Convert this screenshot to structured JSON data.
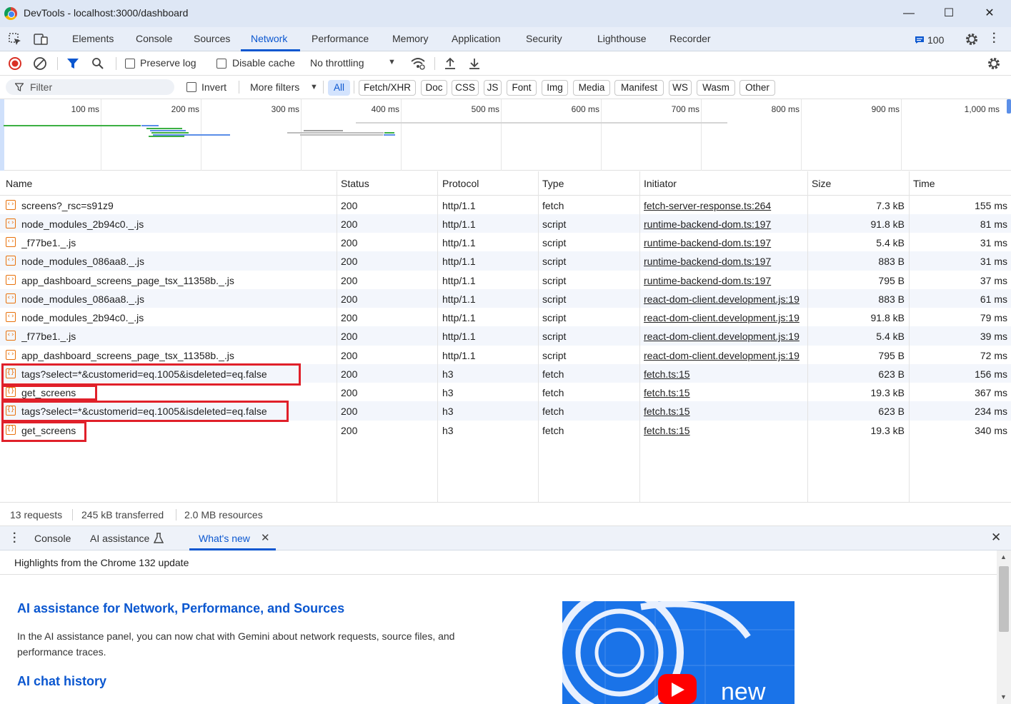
{
  "window": {
    "title": "DevTools - localhost:3000/dashboard",
    "minimize": "—",
    "maximize": "☐",
    "close": "✕"
  },
  "tabs": [
    "Elements",
    "Console",
    "Sources",
    "Network",
    "Performance",
    "Memory",
    "Application",
    "Security",
    "Lighthouse",
    "Recorder"
  ],
  "active_tab": "Network",
  "issues_count": "100",
  "toolbar": {
    "preserve_log": "Preserve log",
    "disable_cache": "Disable cache",
    "throttling": "No throttling"
  },
  "filter": {
    "placeholder": "Filter",
    "invert": "Invert",
    "more_filters": "More filters",
    "chips": [
      "All",
      "Fetch/XHR",
      "Doc",
      "CSS",
      "JS",
      "Font",
      "Img",
      "Media",
      "Manifest",
      "WS",
      "Wasm",
      "Other"
    ],
    "active_chip": "All"
  },
  "overview_ticks": [
    "100 ms",
    "200 ms",
    "300 ms",
    "400 ms",
    "500 ms",
    "600 ms",
    "700 ms",
    "800 ms",
    "900 ms",
    "1,000 ms"
  ],
  "columns": [
    "Name",
    "Status",
    "Protocol",
    "Type",
    "Initiator",
    "Size",
    "Time"
  ],
  "rows": [
    {
      "name": "screens?_rsc=s91z9",
      "status": "200",
      "protocol": "http/1.1",
      "type": "fetch",
      "initiator": "fetch-server-response.ts:264",
      "size": "7.3 kB",
      "time": "155 ms"
    },
    {
      "name": "node_modules_2b94c0._.js",
      "status": "200",
      "protocol": "http/1.1",
      "type": "script",
      "initiator": "runtime-backend-dom.ts:197",
      "size": "91.8 kB",
      "time": "81 ms"
    },
    {
      "name": "_f77be1._.js",
      "status": "200",
      "protocol": "http/1.1",
      "type": "script",
      "initiator": "runtime-backend-dom.ts:197",
      "size": "5.4 kB",
      "time": "31 ms"
    },
    {
      "name": "node_modules_086aa8._.js",
      "status": "200",
      "protocol": "http/1.1",
      "type": "script",
      "initiator": "runtime-backend-dom.ts:197",
      "size": "883 B",
      "time": "31 ms"
    },
    {
      "name": "app_dashboard_screens_page_tsx_11358b._.js",
      "status": "200",
      "protocol": "http/1.1",
      "type": "script",
      "initiator": "runtime-backend-dom.ts:197",
      "size": "795 B",
      "time": "37 ms"
    },
    {
      "name": "node_modules_086aa8._.js",
      "status": "200",
      "protocol": "http/1.1",
      "type": "script",
      "initiator": "react-dom-client.development.js:19",
      "size": "883 B",
      "time": "61 ms"
    },
    {
      "name": "node_modules_2b94c0._.js",
      "status": "200",
      "protocol": "http/1.1",
      "type": "script",
      "initiator": "react-dom-client.development.js:19",
      "size": "91.8 kB",
      "time": "79 ms"
    },
    {
      "name": "_f77be1._.js",
      "status": "200",
      "protocol": "http/1.1",
      "type": "script",
      "initiator": "react-dom-client.development.js:19",
      "size": "5.4 kB",
      "time": "39 ms"
    },
    {
      "name": "app_dashboard_screens_page_tsx_11358b._.js",
      "status": "200",
      "protocol": "http/1.1",
      "type": "script",
      "initiator": "react-dom-client.development.js:19",
      "size": "795 B",
      "time": "72 ms"
    },
    {
      "name": "tags?select=*&customerid=eq.1005&isdeleted=eq.false",
      "status": "200",
      "protocol": "h3",
      "type": "fetch",
      "initiator": "fetch.ts:15",
      "size": "623 B",
      "time": "156 ms"
    },
    {
      "name": "get_screens",
      "status": "200",
      "protocol": "h3",
      "type": "fetch",
      "initiator": "fetch.ts:15",
      "size": "19.3 kB",
      "time": "367 ms"
    },
    {
      "name": "tags?select=*&customerid=eq.1005&isdeleted=eq.false",
      "status": "200",
      "protocol": "h3",
      "type": "fetch",
      "initiator": "fetch.ts:15",
      "size": "623 B",
      "time": "234 ms"
    },
    {
      "name": "get_screens",
      "status": "200",
      "protocol": "h3",
      "type": "fetch",
      "initiator": "fetch.ts:15",
      "size": "19.3 kB",
      "time": "340 ms"
    }
  ],
  "status": {
    "requests": "13 requests",
    "transferred": "245 kB transferred",
    "resources": "2.0 MB resources"
  },
  "drawer": {
    "tabs": [
      "Console",
      "AI assistance",
      "What's new"
    ],
    "active_tab": "What's new",
    "highlights": "Highlights from the Chrome 132 update",
    "heading1": "AI assistance for Network, Performance, and Sources",
    "para1": "In the AI assistance panel, you can now chat with Gemini about network requests, source files, and performance traces.",
    "heading2": "AI chat history",
    "promo_word": "new"
  },
  "colors": {
    "accent": "#0b57d0",
    "highlight_box": "#e0202a",
    "row_alt": "#f3f6fc"
  }
}
